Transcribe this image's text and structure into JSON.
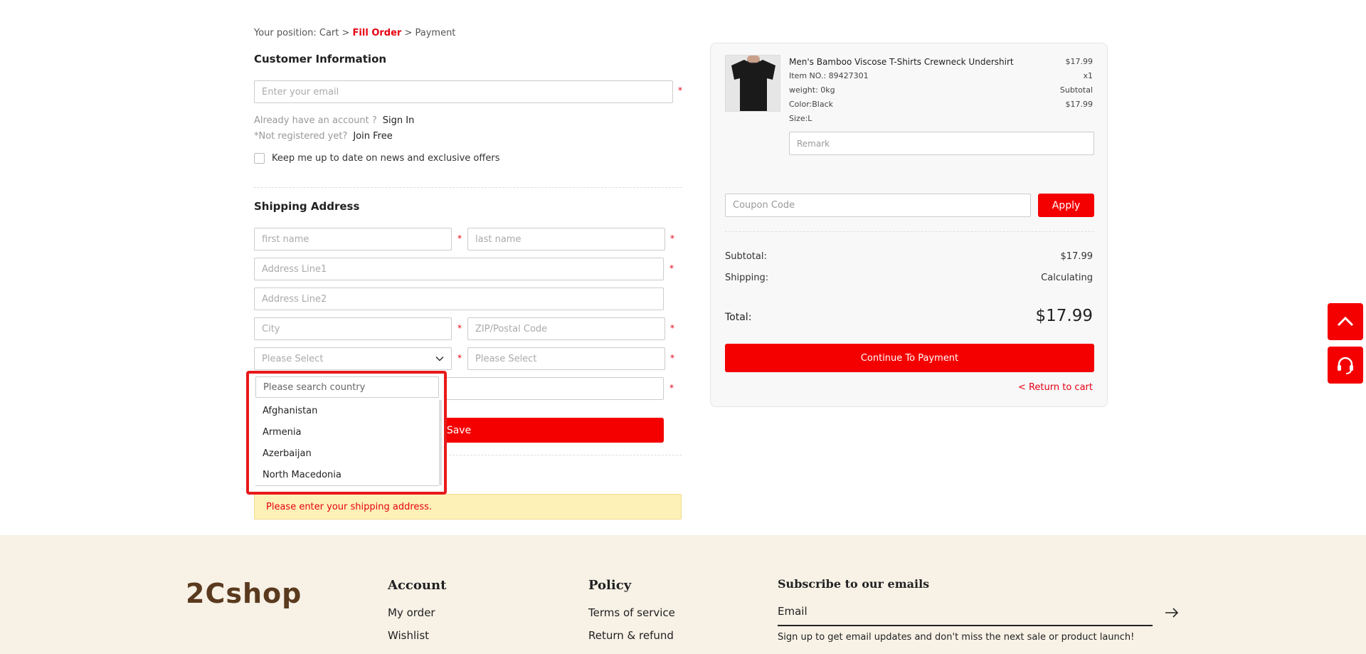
{
  "breadcrumb": {
    "prefix": "Your position: Cart >",
    "current": "Fill Order",
    "suffix": "> Payment"
  },
  "customer": {
    "title": "Customer Information",
    "email_placeholder": "Enter your email",
    "have_account": "Already have an account ?",
    "sign_in": "Sign In",
    "not_registered": "*Not registered yet?",
    "join_free": "Join Free",
    "newsletter_label": "Keep me up to date on news and exclusive offers"
  },
  "shipping": {
    "title": "Shipping Address",
    "first_name": "first name",
    "last_name": "last name",
    "address1": "Address Line1",
    "address2": "Address Line2",
    "city": "City",
    "zip": "ZIP/Postal Code",
    "country_select": "Please Select",
    "state_select": "Please Select",
    "save_label": "Save",
    "required": "*"
  },
  "country_dropdown": {
    "search_placeholder": "Please search country",
    "options": [
      "Afghanistan",
      "Armenia",
      "Azerbaijan",
      "North Macedonia"
    ]
  },
  "alert": {
    "message": "Please enter your shipping address."
  },
  "order": {
    "product_name": "Men's Bamboo Viscose T-Shirts Crewneck Undershirt",
    "item_no": "Item NO.: 89427301",
    "weight": "weight: 0kg",
    "color": "Color:Black",
    "size": "Size:L",
    "price": "$17.99",
    "qty": "x1",
    "subtotal_label": "Subtotal",
    "subtotal_value": "$17.99",
    "remark_placeholder": "Remark",
    "coupon_placeholder": "Coupon Code",
    "apply_label": "Apply",
    "summary_subtotal_label": "Subtotal:",
    "summary_subtotal_value": "$17.99",
    "shipping_label": "Shipping:",
    "shipping_value": "Calculating",
    "total_label": "Total:",
    "total_value": "$17.99",
    "continue_label": "Continue To Payment",
    "return_label": "< Return to cart"
  },
  "footer": {
    "logo": "2Cshop",
    "account_title": "Account",
    "account_links": [
      "My order",
      "Wishlist"
    ],
    "policy_title": "Policy",
    "policy_links": [
      "Terms of service",
      "Return & refund"
    ],
    "subscribe_title": "Subscribe to our emails",
    "email_placeholder": "Email",
    "subscribe_note": "Sign up to get email updates and don't miss the next sale or product launch!"
  },
  "colors": {
    "accent": "#f40000",
    "alert_bg": "#fdf1b8",
    "footer_bg": "#f7f1e6",
    "logo": "#5a3a1e"
  },
  "icons": [
    "chevron-down-icon",
    "chevron-up-icon",
    "headset-icon",
    "arrow-right-icon"
  ]
}
